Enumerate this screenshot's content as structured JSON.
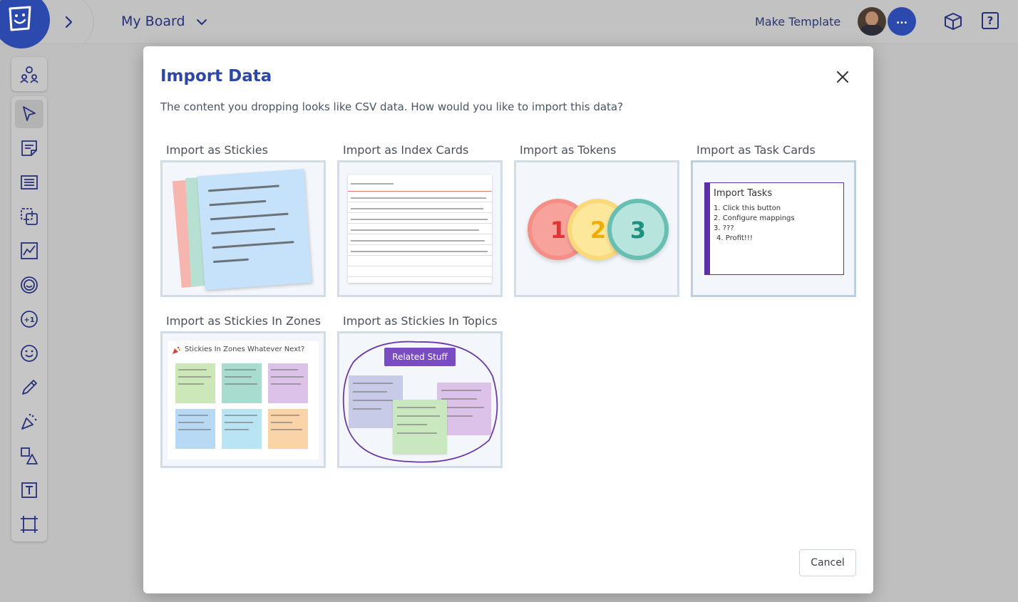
{
  "header": {
    "board_title": "My Board",
    "make_template": "Make Template",
    "more_users": "...",
    "help_glyph": "?"
  },
  "modal": {
    "title": "Import Data",
    "description": "The content you dropping looks like CSV data. How would you like to import this data?",
    "options": [
      {
        "label": "Import as Stickies"
      },
      {
        "label": "Import as Index Cards"
      },
      {
        "label": "Import as Tokens"
      },
      {
        "label": "Import as Task Cards"
      },
      {
        "label": "Import as Stickies In Zones"
      },
      {
        "label": "Import as Stickies In Topics"
      }
    ],
    "cancel_label": "Cancel"
  },
  "previews": {
    "tokens": [
      "1",
      "2",
      "3"
    ],
    "task_card": {
      "title": "Import Tasks",
      "lines": [
        "1. Click this button",
        "2. Configure mappings",
        "3. ???",
        "4. Profit!!!"
      ]
    },
    "zones_title": "Stickies In Zones Whatever Next?",
    "topic_label": "Related Stuff"
  },
  "colors": {
    "brand": "#2c49ad",
    "title_blue": "#2d47a8",
    "task_purple": "#5b2fa6",
    "topic_purple": "#7a4cc2"
  }
}
